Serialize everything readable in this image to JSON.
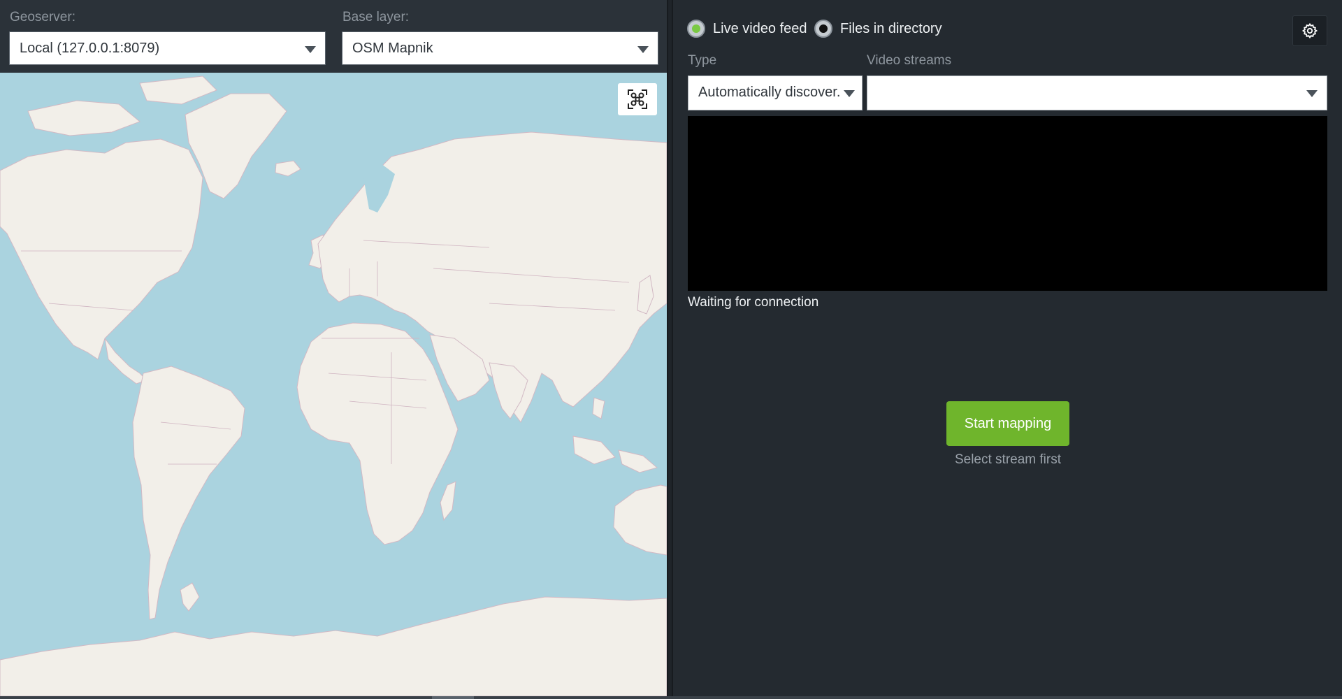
{
  "left": {
    "geoserver_label": "Geoserver:",
    "geoserver_value": "Local (127.0.0.1:8079)",
    "base_layer_label": "Base layer:",
    "base_layer_value": "OSM Mapnik",
    "map_fit_icon": "drone-target-icon"
  },
  "right": {
    "source_options": [
      {
        "label": "Live video feed",
        "selected": true
      },
      {
        "label": "Files in directory",
        "selected": false
      }
    ],
    "settings_icon": "gear-icon",
    "type_label": "Type",
    "type_value": "Automatically discover...",
    "streams_label": "Video streams",
    "streams_value": "",
    "status": "Waiting for connection",
    "start_button": "Start mapping",
    "hint": "Select stream first"
  },
  "colors": {
    "accent": "#6fb52c",
    "radio_selected": "#7ac943",
    "radio_unselected": "#111111",
    "map_water": "#aad3df",
    "map_land": "#f2efe9",
    "panel_bg": "#2b3239"
  }
}
